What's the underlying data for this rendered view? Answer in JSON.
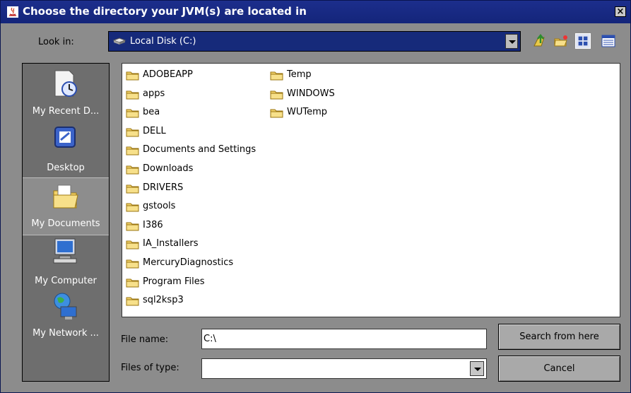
{
  "dialog": {
    "title": "Choose the directory your JVM(s) are located in",
    "close_symbol": "×"
  },
  "look_in": {
    "label": "Look in:",
    "value": "Local Disk (C:)",
    "toolbar": [
      "up-one-level-icon",
      "new-folder-icon",
      "list-view-icon",
      "details-view-icon"
    ]
  },
  "places": [
    {
      "label": "My Recent D...",
      "icon": "recent-documents-icon"
    },
    {
      "label": "Desktop",
      "icon": "desktop-icon"
    },
    {
      "label": "My Documents",
      "icon": "my-documents-icon",
      "selected": true
    },
    {
      "label": "My Computer",
      "icon": "my-computer-icon"
    },
    {
      "label": "My Network ...",
      "icon": "my-network-icon"
    }
  ],
  "files": {
    "column1": [
      "ADOBEAPP",
      "apps",
      "bea",
      "DELL",
      "Documents and Settings",
      "Downloads",
      "DRIVERS",
      "gstools",
      "I386",
      "IA_Installers",
      "MercuryDiagnostics",
      "Program Files",
      "sql2ksp3"
    ],
    "column2": [
      "Temp",
      "WINDOWS",
      "WUTemp"
    ]
  },
  "file_name": {
    "label": "File name:",
    "value": "C:\\"
  },
  "file_type": {
    "label": "Files of type:",
    "value": ""
  },
  "buttons": {
    "search": "Search from here",
    "cancel": "Cancel"
  },
  "colors": {
    "title_bar": "#14257a",
    "panel": "#8c8c8c",
    "places_bg": "#6e6e6e",
    "folder": "#f3d36b"
  }
}
